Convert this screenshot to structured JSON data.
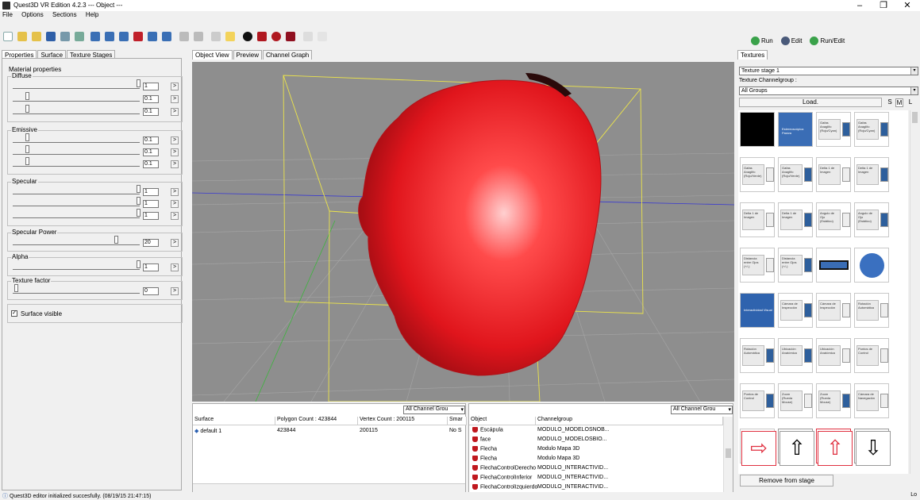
{
  "window": {
    "title": "Quest3D VR Edition 4.2.3   --- Object ---",
    "minimize_glyph": "–",
    "maximize_glyph": "❐",
    "close_glyph": "✕"
  },
  "menu": [
    "File",
    "Options",
    "Sections",
    "Help"
  ],
  "run_buttons": {
    "run": "Run",
    "edit": "Edit",
    "run_edit": "Run/Edit"
  },
  "left_tabs": [
    "Properties",
    "Surface",
    "Texture Stages"
  ],
  "material": {
    "title": "Material properties",
    "diffuse": {
      "label": "Diffuse",
      "values": [
        "1",
        "0.1",
        "0.1"
      ]
    },
    "emissive": {
      "label": "Emissive",
      "values": [
        "0.1",
        "0.1",
        "0.1"
      ]
    },
    "specular": {
      "label": "Specular",
      "values": [
        "1",
        "1",
        "1"
      ]
    },
    "specular_power": {
      "label": "Specular Power",
      "value": "20"
    },
    "alpha": {
      "label": "Alpha",
      "value": "1"
    },
    "texture_factor": {
      "label": "Texture factor",
      "value": "0"
    },
    "surface_visible": "Surface visible",
    "arrow_glyph": ">"
  },
  "center_tabs": [
    "Object View",
    "Preview",
    "Channel Graph"
  ],
  "surface_table": {
    "filter": "All Channel Grou",
    "columns": [
      "Surface",
      "Polygon Count : 423844",
      "Vertex Count : 200115",
      "Smar"
    ],
    "rows": [
      {
        "name": "default 1",
        "polygons": "423844",
        "vertices": "200115",
        "smart": "No S"
      }
    ]
  },
  "object_table": {
    "filter": "All Channel Grou",
    "columns": [
      "Object",
      "Channelgroup"
    ],
    "rows": [
      {
        "object": "Escápula",
        "group": "MODULO_MODELOSNOB..."
      },
      {
        "object": "face",
        "group": "MODULO_MODELOSBIO..."
      },
      {
        "object": "Flecha",
        "group": "Modulo Mapa 3D"
      },
      {
        "object": "Flecha",
        "group": "Modulo Mapa 3D"
      },
      {
        "object": "FlechaControlDerecho",
        "group": "MODULO_INTERACTIVID..."
      },
      {
        "object": "FlechaControlInferior",
        "group": "MODULO_INTERACTIVID..."
      },
      {
        "object": "FlechaControlIzquierdo",
        "group": "MODULO_INTERACTIVID..."
      }
    ]
  },
  "right_panel": {
    "tab": "Textures",
    "texture_stage": "Texture stage 1",
    "channelgroup_label": "Texture Channelgroup :",
    "channelgroup": "All Groups",
    "load": "Load.",
    "size_buttons": [
      "S",
      "M",
      "L"
    ],
    "tiles": [
      "",
      "Estereoscópica Pasiva",
      "Gafas Anaglifo (Rojo/Cyan)",
      "Gafas Anaglifo (Rojo/Cyan)",
      "Gafas Anaglifo (Rojo/Verde)",
      "Gafas Anaglifo (Rojo/Verde)",
      "Delta 1 de Imagen",
      "Delta 1 de Imagen",
      "Delta 1 de Imagen",
      "Delta 1 de Imagen",
      "Angulo de Ojo (Estático)",
      "Angulo de Ojo (Estático)",
      "Distancia entre Ojos (+/-)",
      "Distancia entre Ojos (+/-)",
      "",
      "",
      "Interactividad Visual",
      "Cámara de Inspección",
      "Cámara de Inspección",
      "Rotación Automática",
      "Rotación Automática",
      "Ubicación Anatómica",
      "Ubicación Anatómica",
      "Puntos de Control",
      "Puntos de Control",
      "Zoom (Rueda Mouse)",
      "Zoom (Rueda Mouse)",
      "Cámara de Navegación",
      "Cámara de Navegación"
    ],
    "arrow_tiles": [
      "⇦",
      "⇦",
      "⇨",
      "⇨",
      "⇧",
      "⇧",
      "⇩"
    ],
    "remove": "Remove from stage"
  },
  "status": "Quest3D editor initialized succesfully. (08/19/15 21:47:15)",
  "status_right": "Lo"
}
